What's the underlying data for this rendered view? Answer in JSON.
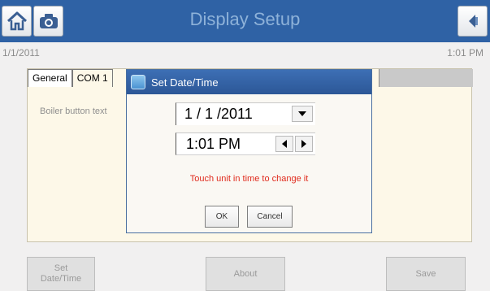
{
  "header": {
    "title": "Display Setup",
    "icons": [
      "home-icon",
      "camera-icon",
      "back-icon"
    ]
  },
  "status": {
    "date": "1/1/2011",
    "time": "1:01 PM"
  },
  "tabs": [
    {
      "label": "General"
    },
    {
      "label": "COM 1"
    }
  ],
  "panel": {
    "field_label": "Boiler button text"
  },
  "dialog": {
    "title": "Set Date/Time",
    "date_value": "1 / 1 /2011",
    "time_value": "1:01 PM",
    "hint": "Touch unit in time to change it",
    "ok_label": "OK",
    "cancel_label": "Cancel"
  },
  "footer": {
    "set_datetime_label": "Set\nDate/Time",
    "about_label": "About",
    "save_label": "Save"
  },
  "colors": {
    "titlebar": "#2f62a5",
    "title_text": "#8eb2d9",
    "hint_text": "#e02a1c",
    "dialog_titlebar": "#2c5797"
  }
}
